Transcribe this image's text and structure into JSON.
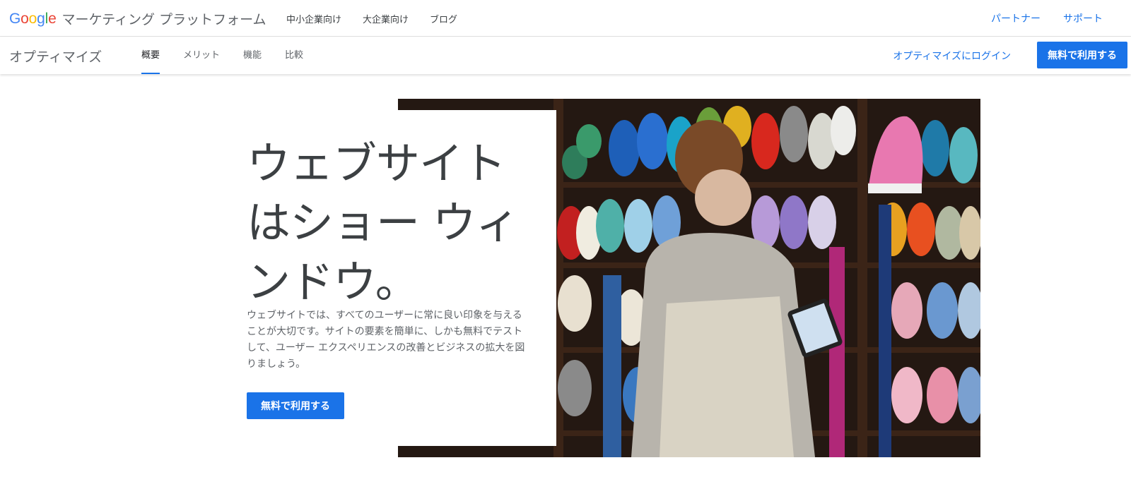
{
  "header": {
    "google_logo": [
      "G",
      "o",
      "o",
      "g",
      "l",
      "e"
    ],
    "logo_colors": [
      "#4285F4",
      "#EA4335",
      "#FBBC05",
      "#4285F4",
      "#34A853",
      "#EA4335"
    ],
    "brand": "マーケティング プラットフォーム",
    "nav": [
      "中小企業向け",
      "大企業向け",
      "ブログ"
    ],
    "links": [
      "パートナー",
      "サポート"
    ]
  },
  "subheader": {
    "product": "オプティマイズ",
    "tabs": [
      "概要",
      "メリット",
      "機能",
      "比較"
    ],
    "active_tab": "概要",
    "login": "オプティマイズにログイン",
    "cta": "無料で利用する"
  },
  "hero": {
    "headline_lines": [
      "ウェブサイト",
      "はショー ウィ",
      "ンドウ。"
    ],
    "body": "ウェブサイトでは、すべてのユーザーに常に良い印象を与えることが大切です。サイトの要素を簡単に、しかも無料でテストして、ユーザー エクスペリエンスの改善とビジネスの拡大を図りましょう。",
    "cta": "無料で利用する",
    "image": "yarn-shop-photo"
  },
  "colors": {
    "accent": "#1a73e8",
    "text": "#3c4043"
  }
}
